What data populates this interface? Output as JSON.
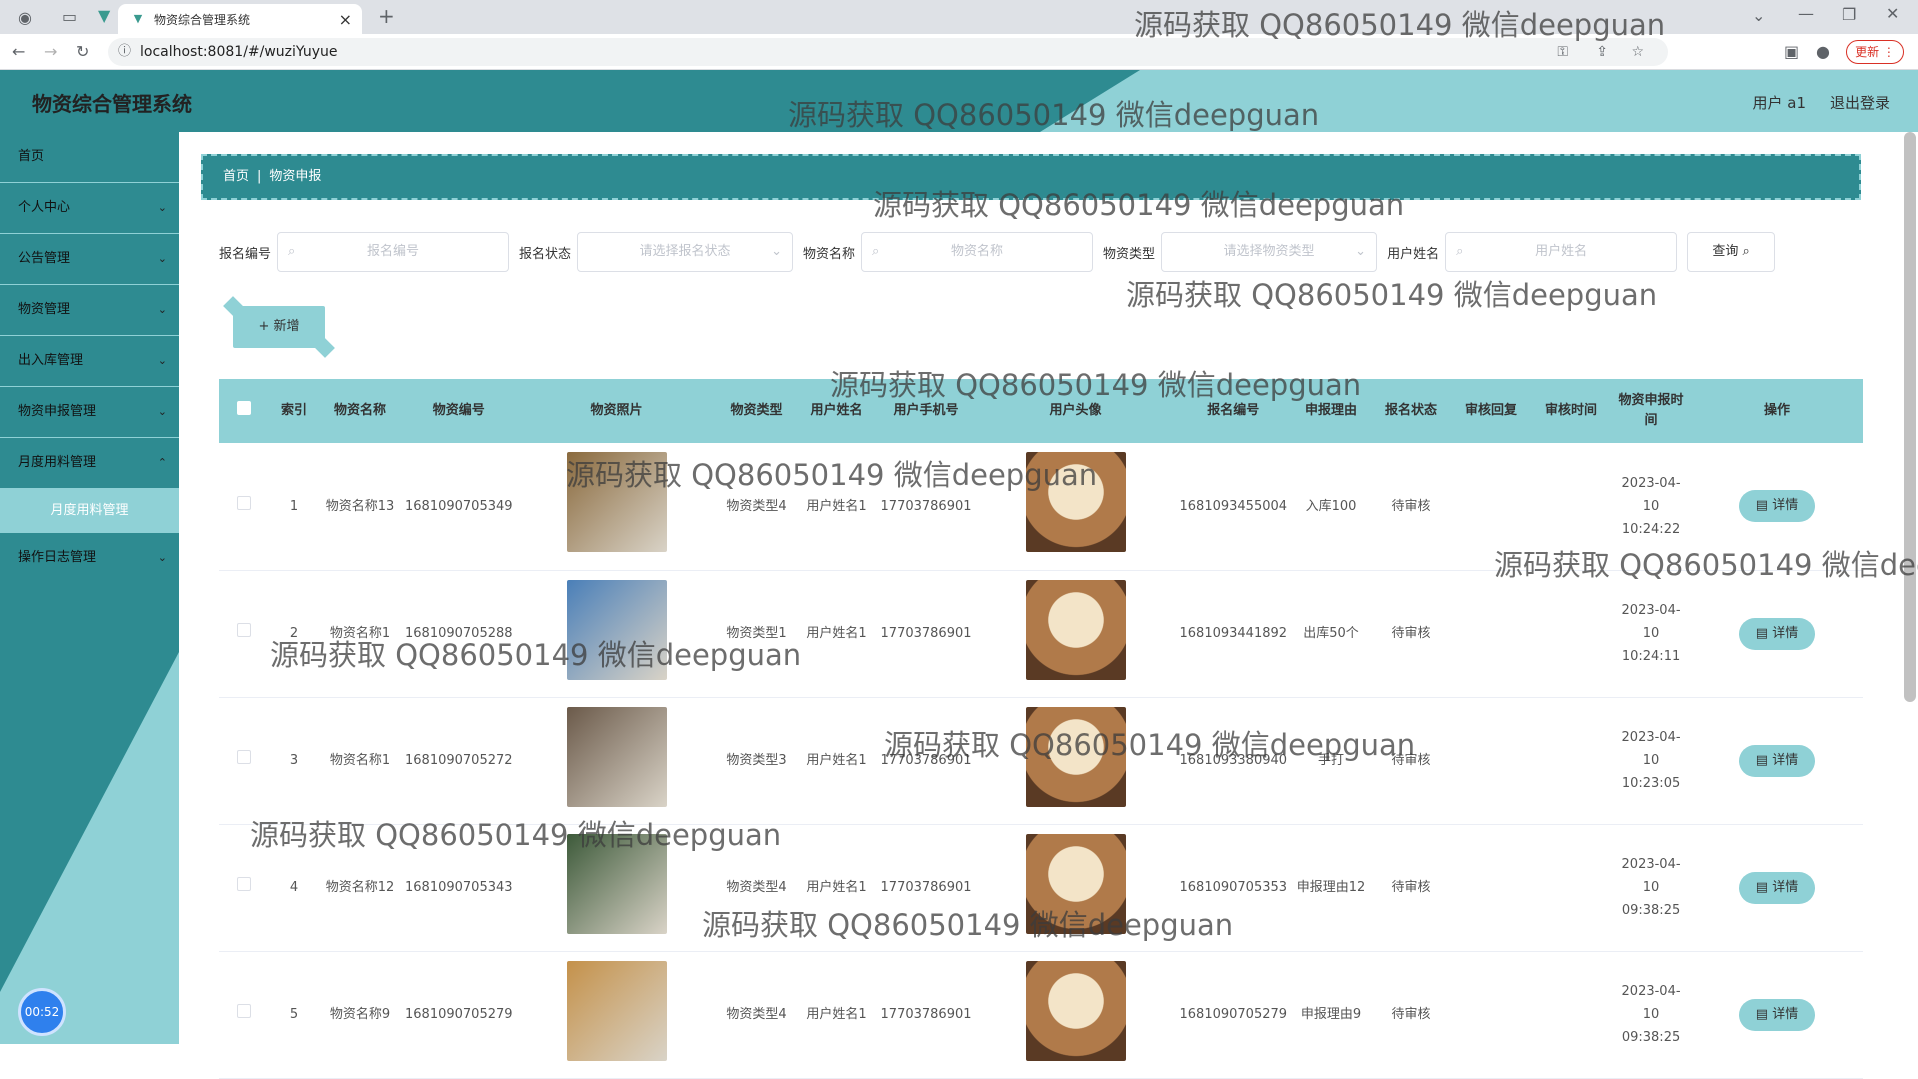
{
  "browser": {
    "tab_title": "物资综合管理系统",
    "url": "localhost:8081/#/wuziYuyue",
    "update_label": "更新"
  },
  "header": {
    "title": "物资综合管理系统",
    "user": "用户 a1",
    "logout": "退出登录"
  },
  "sidebar": {
    "items": [
      {
        "label": "首页",
        "has_children": false
      },
      {
        "label": "个人中心",
        "has_children": true
      },
      {
        "label": "公告管理",
        "has_children": true
      },
      {
        "label": "物资管理",
        "has_children": true
      },
      {
        "label": "出入库管理",
        "has_children": true
      },
      {
        "label": "物资申报管理",
        "has_children": true
      },
      {
        "label": "月度用料管理",
        "has_children": true
      }
    ],
    "sub_item": "月度用料管理",
    "last_item": "操作日志管理",
    "timer": "00:52"
  },
  "breadcrumb": {
    "home": "首页",
    "current": "物资申报"
  },
  "search": {
    "fields": [
      {
        "label": "报名编号",
        "placeholder": "报名编号",
        "type": "input"
      },
      {
        "label": "报名状态",
        "placeholder": "请选择报名状态",
        "type": "select"
      },
      {
        "label": "物资名称",
        "placeholder": "物资名称",
        "type": "input"
      },
      {
        "label": "物资类型",
        "placeholder": "请选择物资类型",
        "type": "select"
      },
      {
        "label": "用户姓名",
        "placeholder": "用户姓名",
        "type": "input"
      }
    ],
    "query_label": "查询"
  },
  "add_label": "+ 新增",
  "table": {
    "columns": [
      "索引",
      "物资名称",
      "物资编号",
      "物资照片",
      "物资类型",
      "用户姓名",
      "用户手机号",
      "用户头像",
      "报名编号",
      "申报理由",
      "报名状态",
      "审核回复",
      "审核时间",
      "物资申报时间",
      "操作"
    ],
    "rows": [
      {
        "index": "1",
        "name": "物资名称13",
        "code": "1681090705349",
        "type": "物资类型4",
        "user": "用户姓名1",
        "phone": "17703786901",
        "reg_no": "1681093455004",
        "reason": "入库100",
        "status": "待审核",
        "reply": "",
        "audit_time": "",
        "apply_time": "2023-04-10 10:24:22",
        "action": "详情",
        "photo_color": "#8a6a3e"
      },
      {
        "index": "2",
        "name": "物资名称1",
        "code": "1681090705288",
        "type": "物资类型1",
        "user": "用户姓名1",
        "phone": "17703786901",
        "reg_no": "1681093441892",
        "reason": "出库50个",
        "status": "待审核",
        "reply": "",
        "audit_time": "",
        "apply_time": "2023-04-10 10:24:11",
        "action": "详情",
        "photo_color": "#4a7fb8"
      },
      {
        "index": "3",
        "name": "物资名称1",
        "code": "1681090705272",
        "type": "物资类型3",
        "user": "用户姓名1",
        "phone": "17703786901",
        "reg_no": "1681093380940",
        "reason": "手打",
        "status": "待审核",
        "reply": "",
        "audit_time": "",
        "apply_time": "2023-04-10 10:23:05",
        "action": "详情",
        "photo_color": "#6b5a4a"
      },
      {
        "index": "4",
        "name": "物资名称12",
        "code": "1681090705343",
        "type": "物资类型4",
        "user": "用户姓名1",
        "phone": "17703786901",
        "reg_no": "1681090705353",
        "reason": "申报理由12",
        "status": "待审核",
        "reply": "",
        "audit_time": "",
        "apply_time": "2023-04-10 09:38:25",
        "action": "详情",
        "photo_color": "#3d5a3a"
      },
      {
        "index": "5",
        "name": "物资名称9",
        "code": "1681090705279",
        "type": "物资类型4",
        "user": "用户姓名1",
        "phone": "17703786901",
        "reg_no": "1681090705279",
        "reason": "申报理由9",
        "status": "待审核",
        "reply": "",
        "audit_time": "",
        "apply_time": "2023-04-10 09:38:25",
        "action": "详情",
        "photo_color": "#c4914a"
      }
    ]
  },
  "watermark": "源码获取 QQ86050149 微信deepguan",
  "colors": {
    "primary": "#2e8b91",
    "light": "#8fd1d6",
    "avatar": "#b07a4a"
  }
}
